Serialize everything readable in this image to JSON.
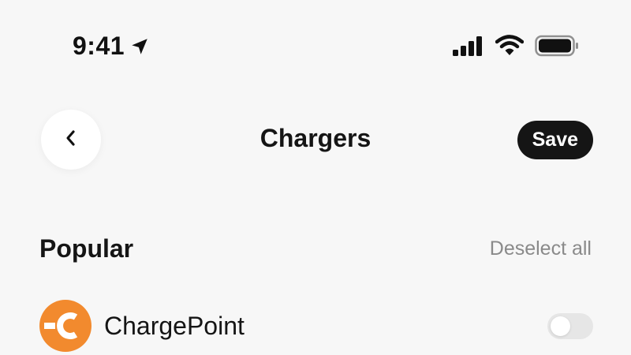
{
  "status_bar": {
    "time": "9:41",
    "icons": [
      "location-arrow-icon",
      "cellular-signal-icon",
      "wifi-icon",
      "battery-icon"
    ]
  },
  "header": {
    "back_icon": "chevron-left-icon",
    "title": "Chargers",
    "save_label": "Save"
  },
  "section": {
    "title": "Popular",
    "deselect_label": "Deselect all"
  },
  "chargers": [
    {
      "name": "ChargePoint",
      "logo_icon": "chargepoint-logo-icon",
      "logo_color": "#f28a2e",
      "enabled": false
    }
  ],
  "colors": {
    "background": "#f7f7f7",
    "primary_button": "#151515",
    "muted_text": "#8a8a8a",
    "toggle_off": "#e6e6e6"
  }
}
